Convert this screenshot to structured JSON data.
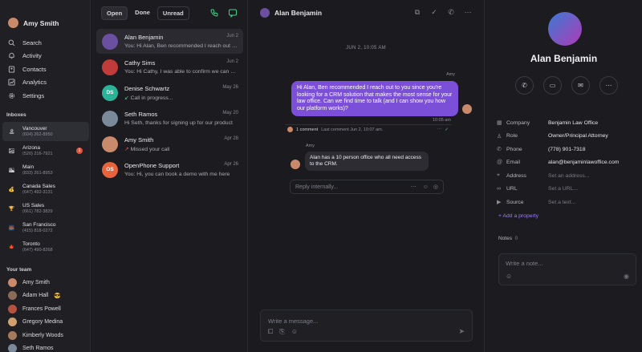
{
  "current_user": {
    "name": "Amy Smith"
  },
  "nav": [
    {
      "label": "Search",
      "icon": "search-icon"
    },
    {
      "label": "Activity",
      "icon": "bell-icon"
    },
    {
      "label": "Contacts",
      "icon": "contacts-icon"
    },
    {
      "label": "Analytics",
      "icon": "analytics-icon"
    },
    {
      "label": "Settings",
      "icon": "gear-icon"
    }
  ],
  "inboxes_title": "Inboxes",
  "inboxes": [
    {
      "name": "Vancouver",
      "phone": "(604) 262-8950",
      "icon": "🏝"
    },
    {
      "name": "Arizona",
      "phone": "(520) 216-7921",
      "icon": "🏜",
      "badge": "1"
    },
    {
      "name": "Main",
      "phone": "(833) 261-8953",
      "icon": "🏙"
    },
    {
      "name": "Canada Sales",
      "phone": "(647) 492-3131",
      "icon": "💰"
    },
    {
      "name": "US Sales",
      "phone": "(661) 782-3829",
      "icon": "🏆"
    },
    {
      "name": "San Francisco",
      "phone": "(415) 818-0272",
      "icon": "🌉"
    },
    {
      "name": "Toronto",
      "phone": "(647) 490-8268",
      "icon": "🍁"
    }
  ],
  "team_title": "Your team",
  "team": [
    {
      "name": "Amy Smith",
      "color": "#c98a6b"
    },
    {
      "name": "Adam Hall",
      "color": "#8a6b5a",
      "emoji": "😎"
    },
    {
      "name": "Frances Powell",
      "color": "#b5523f"
    },
    {
      "name": "Gregory Medina",
      "color": "#d0a070"
    },
    {
      "name": "Kimberly Woods",
      "color": "#a67a5c"
    },
    {
      "name": "Seth Ramos",
      "color": "#7a8a9a"
    }
  ],
  "tabs": {
    "open": "Open",
    "done": "Done",
    "unread": "Unread"
  },
  "conversations": [
    {
      "name": "Alan Benjamin",
      "date": "Jun 2",
      "preview": "You: Hi Alan, Ben recommended I reach out to you since",
      "avatar_color": "#6b4fa0"
    },
    {
      "name": "Cathy Sims",
      "date": "Jun 2",
      "preview": "You: Hi Cathy, I was able to confirm we can do that",
      "avatar_color": "#c23b3b"
    },
    {
      "name": "Denise Schwartz",
      "date": "May 26",
      "preview": "Call in progress...",
      "initials": "DS",
      "avatar_color": "#2bb39a",
      "preview_icon": "incoming-call-icon"
    },
    {
      "name": "Seth Ramos",
      "date": "May 20",
      "preview": "Hi Seth, thanks for signing up for our product",
      "avatar_color": "#7a8a9a"
    },
    {
      "name": "Amy Smith",
      "date": "Apr 28",
      "preview": "Missed your call",
      "avatar_color": "#c98a6b",
      "preview_icon": "missed-call-icon"
    },
    {
      "name": "OpenPhone Support",
      "date": "Apr 26",
      "preview": "You: Hi, you can book a demo with me here",
      "initials": "OS",
      "avatar_color": "#e8623c"
    }
  ],
  "chat": {
    "title": "Alan Benjamin",
    "date_separator": "JUN 2, 10:05 AM",
    "outgoing_sender": "Amy",
    "outgoing_text": "Hi Alan, Ben recommended I reach out to you since you're looking for a CRM solution that makes the most sense for your law office. Can we find time to talk (and I can show you how our platform works)?",
    "outgoing_time": "10:05 am",
    "comment_count": "1 comment",
    "comment_meta": "Last comment Jun 2, 10:07 am.",
    "incoming_sender": "Amy",
    "incoming_text": "Alan has a 10 person office who all need access to the CRM.",
    "reply_placeholder": "Reply internally...",
    "composer_placeholder": "Write a message...",
    "accent": "#7c4fd9"
  },
  "contact": {
    "name": "Alan Benjamin",
    "fields": [
      {
        "label": "Company",
        "value": "Benjamin Law Office",
        "icon": "building-icon"
      },
      {
        "label": "Role",
        "value": "Owner/Principal Attorney",
        "icon": "person-icon"
      },
      {
        "label": "Phone",
        "value": "(778) 901-7318",
        "icon": "phone-icon"
      },
      {
        "label": "Email",
        "value": "alan@benjaminlawoffice.com",
        "icon": "email-icon"
      },
      {
        "label": "Address",
        "value": "Set an address...",
        "icon": "pin-icon",
        "placeholder": true
      },
      {
        "label": "URL",
        "value": "Set a URL...",
        "icon": "link-icon",
        "placeholder": true
      },
      {
        "label": "Source",
        "value": "Set a text...",
        "icon": "source-icon",
        "placeholder": true
      }
    ],
    "add_property": "+ Add a property",
    "notes_label": "Notes",
    "notes_count": "0",
    "note_placeholder": "Write a note..."
  }
}
